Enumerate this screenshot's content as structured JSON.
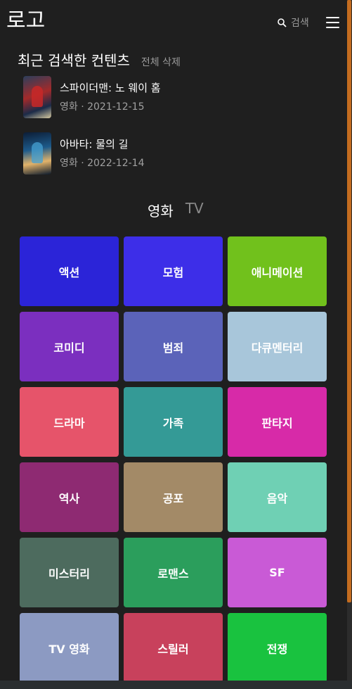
{
  "header": {
    "logo": "로고",
    "search_label": "검색"
  },
  "recent": {
    "title": "최근 검색한 컨텐츠",
    "clear_all": "전체 삭제",
    "items": [
      {
        "title": "스파이더맨: 노 웨이 홈",
        "meta": "영화 · 2021-12-15"
      },
      {
        "title": "아바타: 물의 길",
        "meta": "영화 · 2022-12-14"
      }
    ]
  },
  "tabs": {
    "movie": "영화",
    "tv": "TV"
  },
  "genres": [
    {
      "label": "액션",
      "color": "#2b24d8"
    },
    {
      "label": "모험",
      "color": "#3d2ee8"
    },
    {
      "label": "애니메이션",
      "color": "#71c11c"
    },
    {
      "label": "코미디",
      "color": "#7b2fbf"
    },
    {
      "label": "범죄",
      "color": "#5b63b9"
    },
    {
      "label": "다큐멘터리",
      "color": "#a8c6da"
    },
    {
      "label": "드라마",
      "color": "#e6546a"
    },
    {
      "label": "가족",
      "color": "#349a96"
    },
    {
      "label": "판타지",
      "color": "#d72aa8"
    },
    {
      "label": "역사",
      "color": "#8e2a72"
    },
    {
      "label": "공포",
      "color": "#a38a67"
    },
    {
      "label": "음악",
      "color": "#6fd0b4"
    },
    {
      "label": "미스터리",
      "color": "#4d6b5e"
    },
    {
      "label": "로맨스",
      "color": "#2b9e5c"
    },
    {
      "label": "SF",
      "color": "#c95ad6"
    },
    {
      "label": "TV 영화",
      "color": "#8c9ac2"
    },
    {
      "label": "스릴러",
      "color": "#c8415c"
    },
    {
      "label": "전쟁",
      "color": "#19c23f"
    }
  ]
}
